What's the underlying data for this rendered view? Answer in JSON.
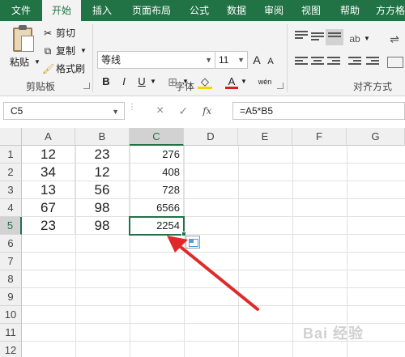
{
  "ribbon_tabs": [
    "文件",
    "开始",
    "插入",
    "页面布局",
    "公式",
    "数据",
    "审阅",
    "视图",
    "帮助",
    "方方格"
  ],
  "active_tab": "开始",
  "clipboard": {
    "paste_label": "粘贴",
    "cut_label": "剪切",
    "copy_label": "复制",
    "format_painter_label": "格式刷",
    "group_label": "剪贴板"
  },
  "font": {
    "font_name": "等线",
    "font_size": "11",
    "grow_label": "A",
    "shrink_label": "A",
    "bold": "B",
    "italic": "I",
    "underline": "U",
    "font_color_label": "A",
    "phonetic_label": "wén",
    "group_label": "字体"
  },
  "alignment": {
    "group_label": "对齐方式"
  },
  "formula_bar": {
    "name_box": "C5",
    "cancel_symbol": "×",
    "enter_symbol": "✓",
    "fx_label": "fx",
    "formula": "=A5*B5"
  },
  "grid": {
    "columns": [
      "A",
      "B",
      "C",
      "D",
      "E",
      "F",
      "G"
    ],
    "rows": [
      "1",
      "2",
      "3",
      "4",
      "5",
      "6",
      "7",
      "8",
      "9",
      "10",
      "11",
      "12"
    ],
    "data": [
      {
        "a": "12",
        "b": "23",
        "c": "276"
      },
      {
        "a": "34",
        "b": "12",
        "c": "408"
      },
      {
        "a": "13",
        "b": "56",
        "c": "728"
      },
      {
        "a": "67",
        "b": "98",
        "c": "6566"
      },
      {
        "a": "23",
        "b": "98",
        "c": "2254"
      }
    ],
    "selected_column": "C",
    "selected_row": "5"
  },
  "colors": {
    "brand_green": "#217346",
    "arrow_red": "#e02a2a"
  },
  "watermark": "Bai 经验"
}
